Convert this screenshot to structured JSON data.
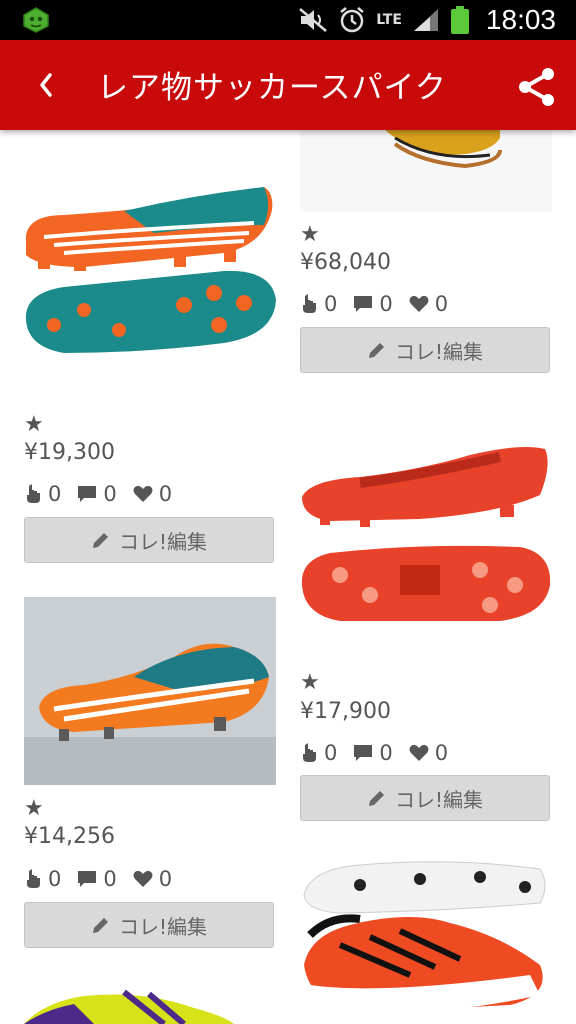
{
  "status_bar": {
    "time": "18:03",
    "network": "LTE"
  },
  "app_bar": {
    "title": "レア物サッカースパイク"
  },
  "colors": {
    "accent": "#c80a0a",
    "button_bg": "#d9d9d9",
    "text_gray": "#555555"
  },
  "icons": [
    "app-notification-icon",
    "mute-icon",
    "alarm-icon",
    "signal-icon",
    "battery-icon",
    "back-icon",
    "share-icon",
    "pencil-icon",
    "hand-icon",
    "comment-icon",
    "heart-icon"
  ],
  "items": [
    {
      "star": "★",
      "price": "¥68,040",
      "likes": "0",
      "comments": "0",
      "hearts": "0",
      "edit_label": "コレ!編集"
    },
    {
      "star": "★",
      "price": "¥19,300",
      "likes": "0",
      "comments": "0",
      "hearts": "0",
      "edit_label": "コレ!編集"
    },
    {
      "star": "★",
      "price": "¥17,900",
      "likes": "0",
      "comments": "0",
      "hearts": "0",
      "edit_label": "コレ!編集"
    },
    {
      "star": "★",
      "price": "¥14,256",
      "likes": "0",
      "comments": "0",
      "hearts": "0",
      "edit_label": "コレ!編集"
    }
  ]
}
